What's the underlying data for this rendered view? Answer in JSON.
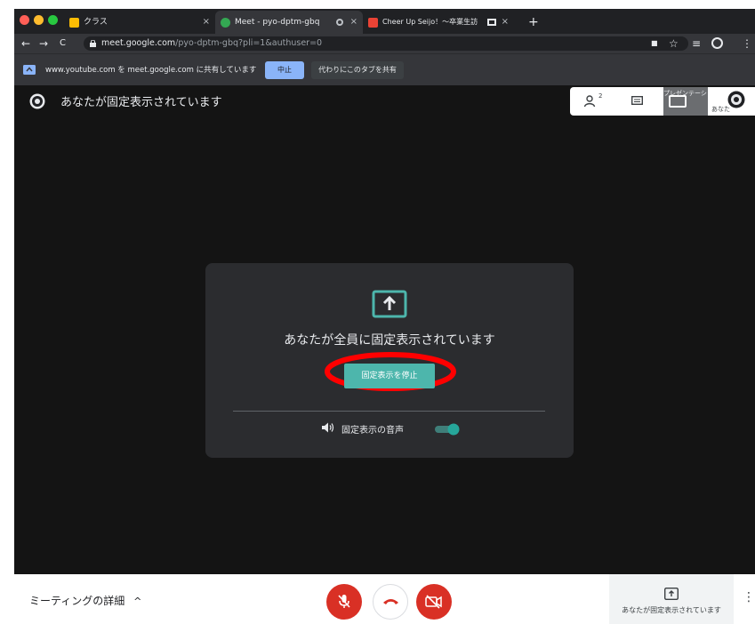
{
  "browser": {
    "tabs": [
      {
        "title": "クラス",
        "close": "×",
        "favicon_color": "#fbbc04"
      },
      {
        "title": "Meet - pyo-dptm-gbq",
        "close": "×",
        "favicon_color": "#34a853"
      },
      {
        "title": "Cheer Up Seijo！〜卒業生訪",
        "close": "×",
        "favicon_color": "#ea4335"
      }
    ],
    "new_tab": "+",
    "nav": {
      "back": "←",
      "forward": "→",
      "reload": "C"
    },
    "address": {
      "host": "meet.google.com",
      "path": "/pyo-dptm-gbq?pli=1&authuser=0"
    },
    "toolbar_icons": {
      "camera": "■",
      "star": "☆",
      "media": "≡",
      "menu": "⋮"
    }
  },
  "share_bar": {
    "text": "www.youtube.com を meet.google.com に共有しています",
    "stop_label": "中止",
    "share_tab_label": "代わりにこのタブを共有"
  },
  "meet": {
    "pinned_label": "あなたが固定表示されています",
    "participant_count": "2",
    "tiles": [
      {
        "label": "プレゼンテーション（あなた）"
      },
      {
        "label": "あなた"
      }
    ],
    "card": {
      "title": "あなたが全員に固定表示されています",
      "stop_button": "固定表示を停止",
      "audio_label": "固定表示の音声",
      "audio_enabled": true
    }
  },
  "bottom": {
    "details_label": "ミーティングの詳細",
    "details_chevron": "^",
    "pin_status": "あなたが固定表示されています",
    "more": "⋮"
  },
  "colors": {
    "chrome_dark": "#202124",
    "toolbar": "#35363a",
    "stage": "#141414",
    "card": "#2b2c2f",
    "teal": "#4db6ac",
    "accent_blue": "#8ab4f8",
    "meet_red": "#d93025",
    "annotation_red": "#ff0000"
  }
}
